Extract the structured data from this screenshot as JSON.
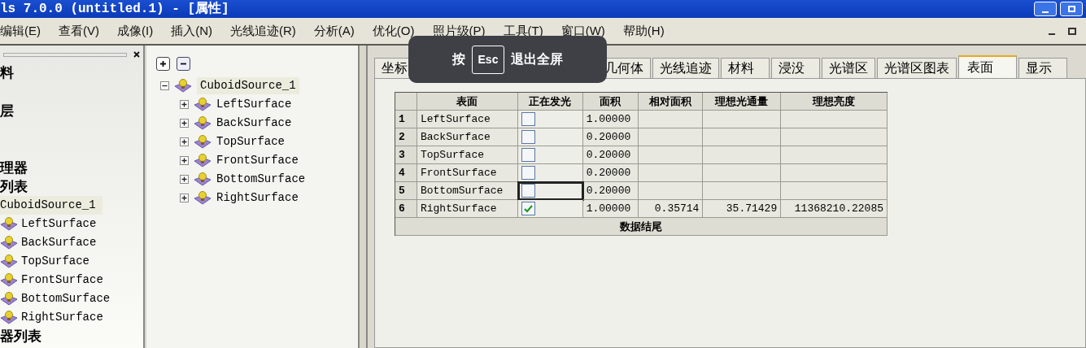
{
  "window": {
    "title": "ls 7.0.0  (untitled.1) - [属性]"
  },
  "menu": [
    "编辑(E)",
    "查看(V)",
    "成像(I)",
    "插入(N)",
    "光线追迹(R)",
    "分析(A)",
    "优化(O)",
    "照片级(P)",
    "工具(T)",
    "窗口(W)",
    "帮助(H)"
  ],
  "left_panel": {
    "items": [
      {
        "kind": "heading",
        "label": "料"
      },
      {
        "kind": "heading",
        "label": "层"
      },
      {
        "kind": "gap"
      },
      {
        "kind": "heading",
        "label": "理器"
      },
      {
        "kind": "heading",
        "label": "列表"
      },
      {
        "kind": "source",
        "label": "CuboidSource_1",
        "selected": true
      },
      {
        "kind": "surface",
        "label": "LeftSurface"
      },
      {
        "kind": "surface",
        "label": "BackSurface"
      },
      {
        "kind": "surface",
        "label": "TopSurface"
      },
      {
        "kind": "surface",
        "label": "FrontSurface"
      },
      {
        "kind": "surface",
        "label": "BottomSurface"
      },
      {
        "kind": "surface",
        "label": "RightSurface"
      },
      {
        "kind": "heading",
        "label": "器列表"
      }
    ]
  },
  "tree": {
    "label": "CuboidSource_1",
    "expanded": true,
    "selected": true,
    "children": [
      {
        "label": "LeftSurface",
        "expanded": false
      },
      {
        "label": "BackSurface",
        "expanded": false
      },
      {
        "label": "TopSurface",
        "expanded": false
      },
      {
        "label": "FrontSurface",
        "expanded": false
      },
      {
        "label": "BottomSurface",
        "expanded": false
      },
      {
        "label": "RightSurface",
        "expanded": false
      }
    ]
  },
  "tabs": [
    {
      "label": "坐标",
      "selected": false
    },
    {
      "kind": "hidden"
    },
    {
      "label": "几何体",
      "selected": false
    },
    {
      "label": "光线追迹",
      "selected": false
    },
    {
      "label": "材料",
      "selected": false
    },
    {
      "label": "浸没",
      "selected": false
    },
    {
      "label": "光谱区",
      "selected": false
    },
    {
      "label": "光谱区图表",
      "selected": false
    },
    {
      "label": "表面",
      "selected": true
    },
    {
      "label": "显示",
      "selected": false
    }
  ],
  "overlay": {
    "before": "按",
    "key": "Esc",
    "after": "退出全屏"
  },
  "table": {
    "columns": [
      "表面",
      "正在发光",
      "面积",
      "相对面积",
      "理想光通量",
      "理想亮度"
    ],
    "rows": [
      {
        "index": "1",
        "surface": "LeftSurface",
        "emitting": false,
        "focused": false,
        "area": "1.00000"
      },
      {
        "index": "2",
        "surface": "BackSurface",
        "emitting": false,
        "focused": false,
        "area": "0.20000"
      },
      {
        "index": "3",
        "surface": "TopSurface",
        "emitting": false,
        "focused": false,
        "area": "0.20000"
      },
      {
        "index": "4",
        "surface": "FrontSurface",
        "emitting": false,
        "focused": false,
        "area": "0.20000"
      },
      {
        "index": "5",
        "surface": "BottomSurface",
        "emitting": false,
        "focused": true,
        "area": "0.20000"
      },
      {
        "index": "6",
        "surface": "RightSurface",
        "emitting": true,
        "focused": false,
        "area": "1.00000",
        "relative_area": "0.35714",
        "flux": "35.71429",
        "luminance": "11368210.22085"
      }
    ],
    "footer": "数据结尾"
  }
}
